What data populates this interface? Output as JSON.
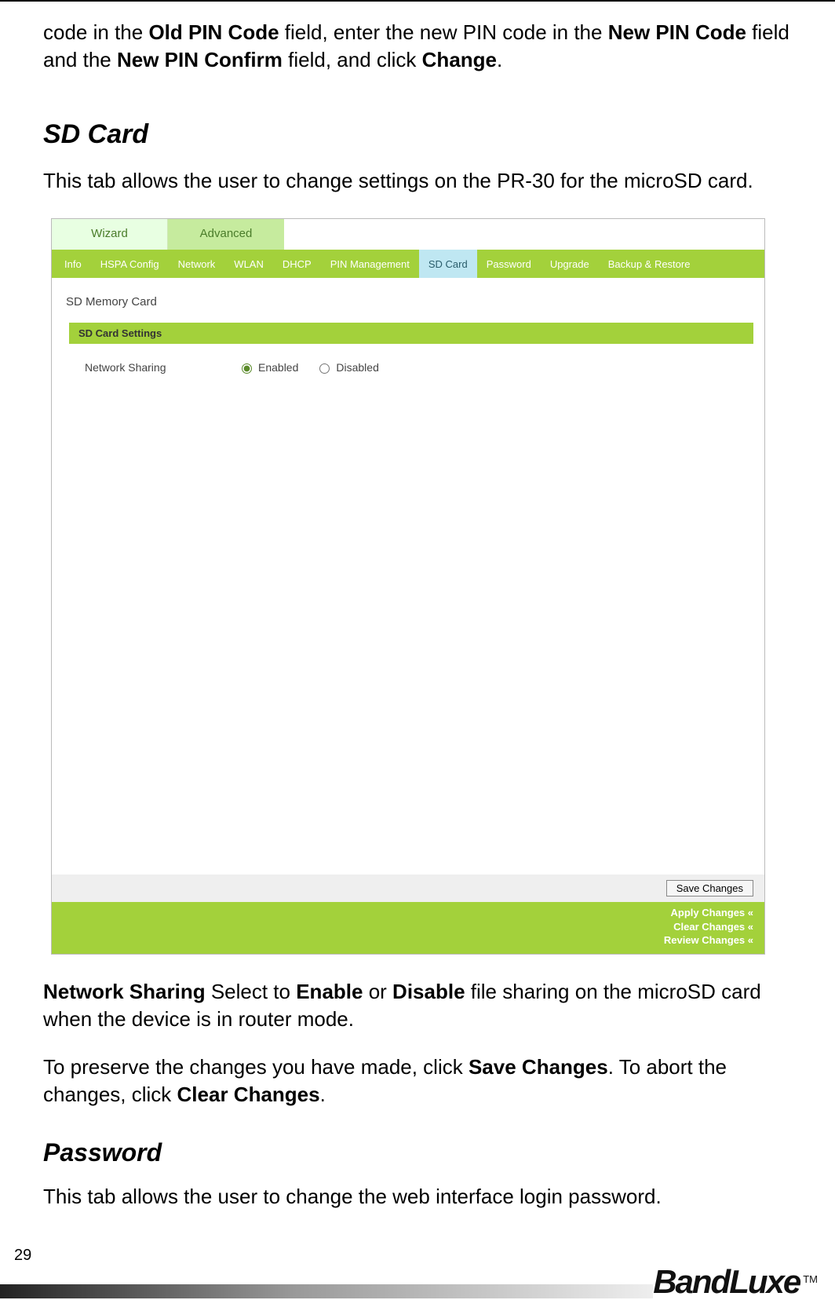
{
  "intro": {
    "p1a": "code in the ",
    "p1b": "Old PIN Code",
    "p1c": " field, enter the new PIN code in the ",
    "p1d": "New PIN Code",
    "p1e": " field and the ",
    "p1f": "New PIN Confirm",
    "p1g": " field, and click ",
    "p1h": "Change",
    "p1i": "."
  },
  "sdcard": {
    "heading": "SD Card",
    "desc": "This tab allows the user to change settings on the PR-30 for the microSD card."
  },
  "screenshot": {
    "top_tabs": {
      "wizard": "Wizard",
      "advanced": "Advanced"
    },
    "sub_tabs": [
      "Info",
      "HSPA Config",
      "Network",
      "WLAN",
      "DHCP",
      "PIN Management",
      "SD Card",
      "Password",
      "Upgrade",
      "Backup & Restore"
    ],
    "panel_title": "SD Memory Card",
    "section_bar": "SD Card Settings",
    "form": {
      "label": "Network Sharing",
      "enabled": "Enabled",
      "disabled": "Disabled"
    },
    "save_button": "Save Changes",
    "footer_links": {
      "apply": "Apply Changes «",
      "clear": "Clear Changes «",
      "review": "Review Changes «"
    }
  },
  "after": {
    "p1": {
      "a": "Network Sharing",
      "b": " Select to ",
      "c": "Enable",
      "d": " or ",
      "e": "Disable",
      "f": " file sharing on the microSD card when the device is in router mode."
    },
    "p2": {
      "a": "To preserve the changes you have made, click ",
      "b": "Save Changes",
      "c": ". To abort the changes, click ",
      "d": "Clear Changes",
      "e": "."
    }
  },
  "password": {
    "heading": "Password",
    "desc": "This tab allows the user to change the web interface login password."
  },
  "page_number": "29",
  "brand": "BandLuxe",
  "tm": "TM"
}
